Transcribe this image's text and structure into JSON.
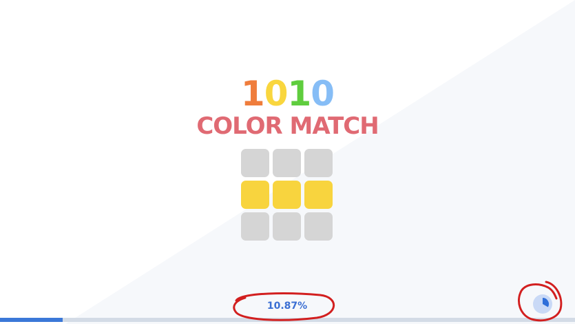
{
  "title": {
    "digits": [
      {
        "char": "1",
        "color": "#ef7d3c"
      },
      {
        "char": "0",
        "color": "#f9d63e"
      },
      {
        "char": "1",
        "color": "#5fcd3e"
      },
      {
        "char": "0",
        "color": "#86bdf6"
      }
    ],
    "subtitle": "COLOR MATCH",
    "subtitle_color": "#e06a73"
  },
  "logo_grid": {
    "rows": [
      [
        "gray",
        "gray",
        "gray"
      ],
      [
        "yellow",
        "yellow",
        "yellow"
      ],
      [
        "gray",
        "gray",
        "gray"
      ]
    ],
    "colors": {
      "gray": "#d5d5d5",
      "yellow": "#f8d43e"
    }
  },
  "loading": {
    "progress_text": "10.87%",
    "progress_fraction": 0.1087,
    "text_color": "#3b6fd3",
    "fill_color": "#3b78d8",
    "track_color": "#d3dbe6",
    "spinner_icon": "loading-spinner-icon",
    "spinner_bg": "#c9d9f6",
    "spinner_fg": "#2f6fd9"
  },
  "theme": {
    "background": "#ffffff",
    "background_shade": "#f6f8fb",
    "annotation_color": "#d21f1f"
  }
}
